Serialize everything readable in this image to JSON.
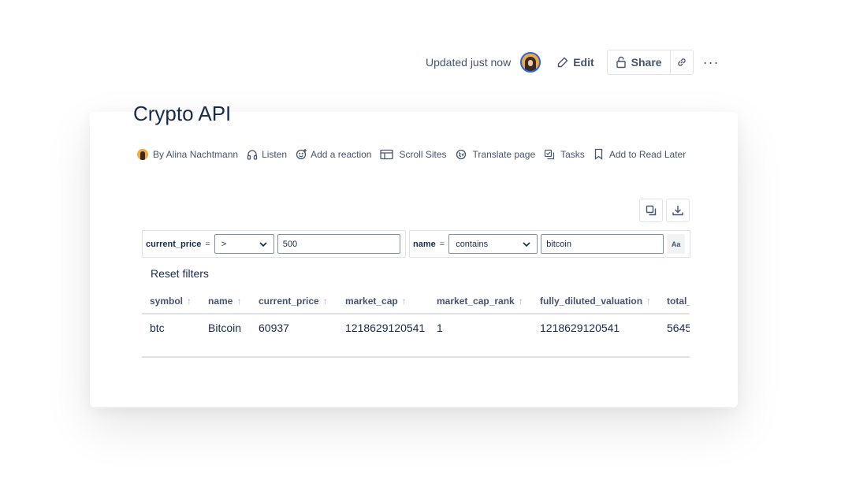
{
  "header": {
    "updated": "Updated just now",
    "edit_label": "Edit",
    "share_label": "Share",
    "more_label": "···"
  },
  "page": {
    "title": "Crypto API"
  },
  "byline": {
    "author": "By Alina Nachtmann",
    "listen": "Listen",
    "reaction": "Add a reaction",
    "scroll_sites": "Scroll Sites",
    "translate": "Translate page",
    "tasks": "Tasks",
    "read_later": "Add to Read Later"
  },
  "filters": [
    {
      "field": "current_price",
      "eq": "=",
      "operator": ">",
      "value": "500"
    },
    {
      "field": "name",
      "eq": "=",
      "operator": "contains",
      "value": "bitcoin",
      "case_toggle": "Aa"
    }
  ],
  "reset_label": "Reset filters",
  "table": {
    "columns": [
      "symbol",
      "name",
      "current_price",
      "market_cap",
      "market_cap_rank",
      "fully_diluted_valuation",
      "total_"
    ],
    "rows": [
      [
        "btc",
        "Bitcoin",
        "60937",
        "1218629120541",
        "1",
        "1218629120541",
        "5645"
      ]
    ]
  },
  "icons": {
    "avatar": "user-avatar",
    "edit": "pencil-icon",
    "share": "unlock-icon",
    "link": "link-icon",
    "copy": "copy-icon",
    "download": "download-icon"
  }
}
